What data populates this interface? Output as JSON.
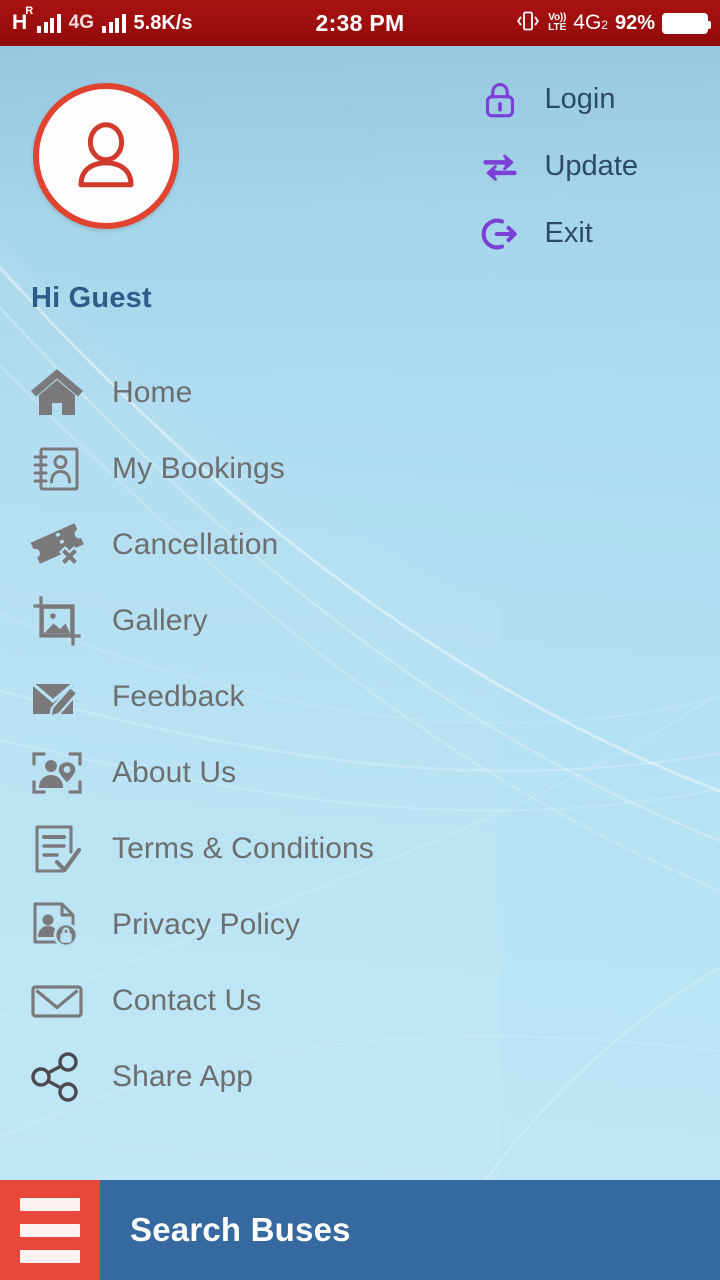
{
  "status_bar": {
    "network_type": "H",
    "roaming_indicator": "R",
    "network_4g": "4G",
    "data_speed": "5.8K/s",
    "time": "2:38 PM",
    "volte_top": "Vo))",
    "volte_bottom": "LTE",
    "sim2_network": "4G",
    "sim2_index": "2",
    "battery_percent": "92%",
    "background_color": "#9c0f0f"
  },
  "header": {
    "greeting": "Hi Guest",
    "avatar_icon": "person-icon",
    "avatar_border_color": "#e0432f",
    "greeting_color": "#2c5c88",
    "actions": [
      {
        "label": "Login",
        "icon": "lock-icon"
      },
      {
        "label": "Update",
        "icon": "swap-arrows-icon"
      },
      {
        "label": "Exit",
        "icon": "logout-icon"
      }
    ]
  },
  "menu": {
    "items": [
      {
        "label": "Home",
        "icon": "home-icon"
      },
      {
        "label": "My Bookings",
        "icon": "booking-notebook-icon"
      },
      {
        "label": "Cancellation",
        "icon": "ticket-cancel-icon"
      },
      {
        "label": "Gallery",
        "icon": "image-crop-icon"
      },
      {
        "label": "Feedback",
        "icon": "envelope-pencil-icon"
      },
      {
        "label": "About Us",
        "icon": "person-location-frame-icon"
      },
      {
        "label": "Terms & Conditions",
        "icon": "document-check-icon"
      },
      {
        "label": "Privacy Policy",
        "icon": "document-person-lock-icon"
      },
      {
        "label": "Contact Us",
        "icon": "envelope-outline-icon"
      },
      {
        "label": "Share App",
        "icon": "share-nodes-icon"
      }
    ],
    "label_color": "#6d6e70"
  },
  "bottom_bar": {
    "menu_icon": "hamburger-icon",
    "title": "Search Buses",
    "menu_button_color": "#e8483a",
    "bar_color": "#36699f"
  }
}
